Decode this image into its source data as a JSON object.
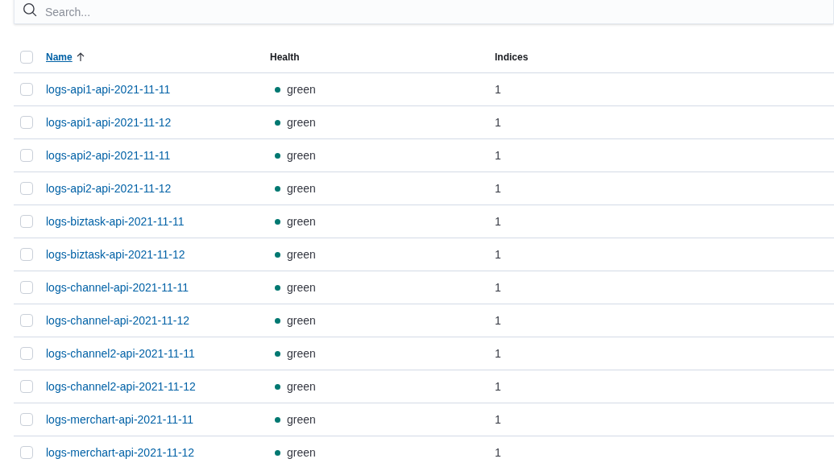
{
  "search": {
    "placeholder": "Search..."
  },
  "table": {
    "select_all": {
      "checked": false
    },
    "columns": [
      {
        "label": "Name",
        "sorted": true
      },
      {
        "label": "Health",
        "sorted": false
      },
      {
        "label": "Indices",
        "sorted": false
      }
    ],
    "rows": [
      {
        "checked": false,
        "name": "logs-api1-api-2021-11-11",
        "health": "green",
        "color": "#007871",
        "indices": "1"
      },
      {
        "checked": false,
        "name": "logs-api1-api-2021-11-12",
        "health": "green",
        "color": "#007871",
        "indices": "1"
      },
      {
        "checked": false,
        "name": "logs-api2-api-2021-11-11",
        "health": "green",
        "color": "#007871",
        "indices": "1"
      },
      {
        "checked": false,
        "name": "logs-api2-api-2021-11-12",
        "health": "green",
        "color": "#007871",
        "indices": "1"
      },
      {
        "checked": false,
        "name": "logs-biztask-api-2021-11-11",
        "health": "green",
        "color": "#007871",
        "indices": "1"
      },
      {
        "checked": false,
        "name": "logs-biztask-api-2021-11-12",
        "health": "green",
        "color": "#007871",
        "indices": "1"
      },
      {
        "checked": false,
        "name": "logs-channel-api-2021-11-11",
        "health": "green",
        "color": "#007871",
        "indices": "1"
      },
      {
        "checked": false,
        "name": "logs-channel-api-2021-11-12",
        "health": "green",
        "color": "#007871",
        "indices": "1"
      },
      {
        "checked": false,
        "name": "logs-channel2-api-2021-11-11",
        "health": "green",
        "color": "#007871",
        "indices": "1"
      },
      {
        "checked": false,
        "name": "logs-channel2-api-2021-11-12",
        "health": "green",
        "color": "#007871",
        "indices": "1"
      },
      {
        "checked": false,
        "name": "logs-merchart-api-2021-11-11",
        "health": "green",
        "color": "#007871",
        "indices": "1"
      },
      {
        "checked": false,
        "name": "logs-merchart-api-2021-11-12",
        "health": "green",
        "color": "#007871",
        "indices": "1"
      }
    ]
  }
}
